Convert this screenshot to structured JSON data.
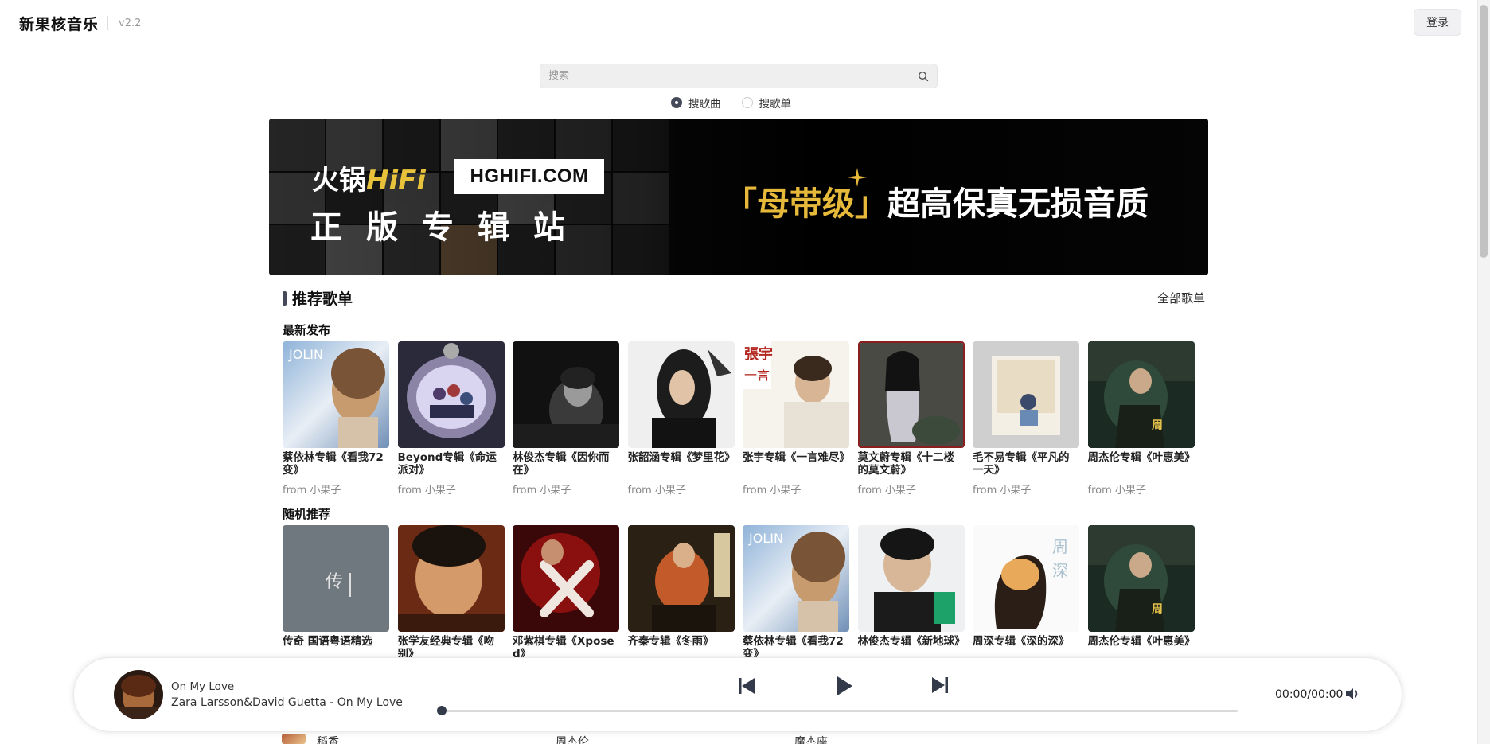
{
  "header": {
    "brand": "新果核音乐",
    "version": "v2.2",
    "login_label": "登录"
  },
  "search": {
    "placeholder": "搜索",
    "value": "",
    "options": [
      {
        "label": "搜歌曲",
        "selected": true
      },
      {
        "label": "搜歌单",
        "selected": false
      }
    ]
  },
  "banner": {
    "brand_cn": "火锅",
    "brand_hifi": "HiFi",
    "site": "HGHIFI.COM",
    "slogan_left": "正版专辑站",
    "tag_open": "「",
    "tag_word": "母带级",
    "tag_close": "」",
    "tag_rest": "超高保真无损音质"
  },
  "section": {
    "title": "推荐歌单",
    "more_label": "全部歌单"
  },
  "latest": {
    "title": "最新发布",
    "items": [
      {
        "title": "蔡依林专辑《看我72变》",
        "from": "from 小果子"
      },
      {
        "title": "Beyond专辑《命运派对》",
        "from": "from 小果子"
      },
      {
        "title": "林俊杰专辑《因你而在》",
        "from": "from 小果子"
      },
      {
        "title": "张韶涵专辑《梦里花》",
        "from": "from 小果子"
      },
      {
        "title": "张宇专辑《一言难尽》",
        "from": "from 小果子"
      },
      {
        "title": "莫文蔚专辑《十二楼的莫文蔚》",
        "from": "from 小果子"
      },
      {
        "title": "毛不易专辑《平凡的一天》",
        "from": "from 小果子"
      },
      {
        "title": "周杰伦专辑《叶惠美》",
        "from": "from 小果子"
      }
    ]
  },
  "random": {
    "title": "随机推荐",
    "items": [
      {
        "title": "传奇 国语粤语精选"
      },
      {
        "title": "张学友经典专辑《吻别》"
      },
      {
        "title": "邓紫棋专辑《Xposed》"
      },
      {
        "title": "齐秦专辑《冬雨》"
      },
      {
        "title": "蔡依林专辑《看我72变》"
      },
      {
        "title": "林俊杰专辑《新地球》"
      },
      {
        "title": "周深专辑《深的深》"
      },
      {
        "title": "周杰伦专辑《叶惠美》"
      }
    ]
  },
  "peek_row": [
    "稻香",
    "周杰伦",
    "魔杰座"
  ],
  "player": {
    "title": "On My Love",
    "artist_song": "Zara Larsson&David Guetta - On My Love",
    "time": "00:00/00:00",
    "progress": 0
  },
  "colors": {
    "accent": "#444a5a",
    "gold": "#e7b93a"
  }
}
